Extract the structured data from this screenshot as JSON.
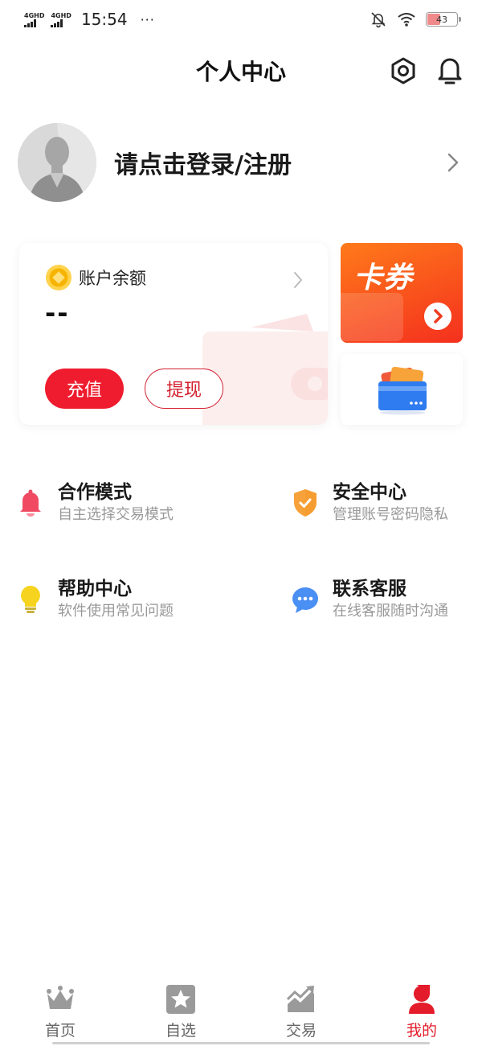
{
  "status_bar": {
    "network_1": "4GHD",
    "network_2": "4GHD",
    "time": "15:54",
    "more": "···",
    "battery": "43"
  },
  "header": {
    "title": "个人中心"
  },
  "profile": {
    "login_prompt": "请点击登录/注册"
  },
  "balance": {
    "label": "账户余额",
    "value": "--",
    "recharge_label": "充值",
    "withdraw_label": "提现"
  },
  "coupon": {
    "title": "卡券"
  },
  "menu": [
    {
      "title": "合作模式",
      "subtitle": "自主选择交易模式",
      "icon": "bell-icon"
    },
    {
      "title": "安全中心",
      "subtitle": "管理账号密码隐私",
      "icon": "shield-icon"
    },
    {
      "title": "帮助中心",
      "subtitle": "软件使用常见问题",
      "icon": "lightbulb-icon"
    },
    {
      "title": "联系客服",
      "subtitle": "在线客服随时沟通",
      "icon": "chat-icon"
    }
  ],
  "bottom_nav": [
    {
      "label": "首页",
      "icon": "crown-icon"
    },
    {
      "label": "自选",
      "icon": "star-icon"
    },
    {
      "label": "交易",
      "icon": "chart-icon"
    },
    {
      "label": "我的",
      "icon": "user-icon",
      "active": true
    }
  ],
  "colors": {
    "accent": "#ee1c2e",
    "coupon_gradient_start": "#ff7a1a",
    "coupon_gradient_end": "#f4301e"
  }
}
